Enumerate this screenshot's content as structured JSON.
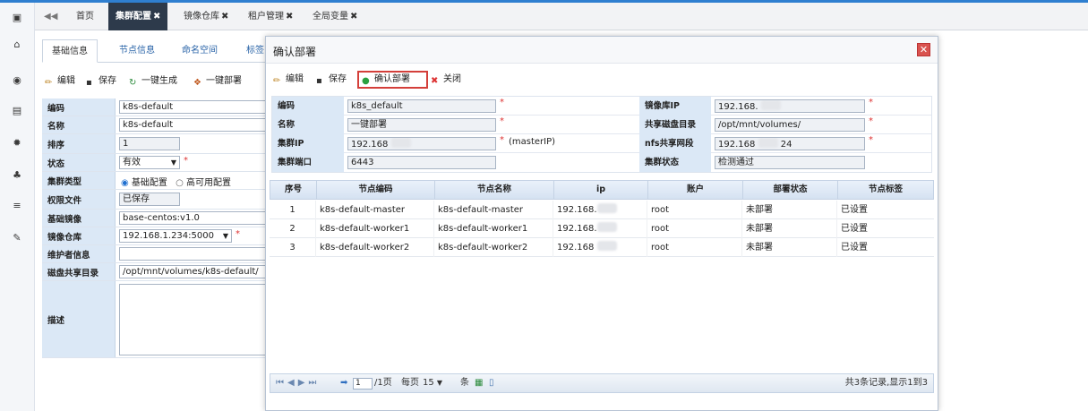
{
  "tabs": {
    "items": [
      "首页",
      "集群配置",
      "镜像仓库",
      "租户管理",
      "全局变量"
    ],
    "active_index": 1
  },
  "subtabs": [
    "基础信息",
    "节点信息",
    "命名空间",
    "标签"
  ],
  "toolbar": {
    "edit": "编辑",
    "save": "保存",
    "generate": "一键生成",
    "deploy": "一键部署"
  },
  "form": {
    "code_label": "编码",
    "code_value": "k8s-default",
    "name_label": "名称",
    "name_value": "k8s-default",
    "sort_label": "排序",
    "sort_value": "1",
    "status_label": "状态",
    "status_value": "有效",
    "type_label": "集群类型",
    "type_opt1": "基础配置",
    "type_opt2": "高可用配置",
    "perm_label": "权限文件",
    "perm_value": "已保存",
    "image_label": "基础镜像",
    "image_value": "base-centos:v1.0",
    "repo_label": "镜像仓库",
    "repo_value": "192.168.1.234:5000",
    "maint_label": "维护者信息",
    "maint_value": "",
    "disk_label": "磁盘共享目录",
    "disk_value": "/opt/mnt/volumes/k8s-default/",
    "desc_label": "描述",
    "desc_value": ""
  },
  "modal": {
    "title": "确认部署",
    "toolbar": {
      "edit": "编辑",
      "save": "保存",
      "confirm": "确认部署",
      "close": "关闭"
    },
    "fields": {
      "code_label": "编码",
      "code_value": "k8s_default",
      "name_label": "名称",
      "name_value": "一键部署",
      "ip_label": "集群IP",
      "ip_value": "192.168",
      "ip_note": "(masterIP)",
      "port_label": "集群端口",
      "port_value": "6443",
      "repoip_label": "镜像库IP",
      "repoip_value": "192.168.",
      "disk_label": "共享磁盘目录",
      "disk_value": "/opt/mnt/volumes/",
      "nfs_label": "nfs共享网段",
      "nfs_value_a": "192.168",
      "nfs_value_b": "24",
      "state_label": "集群状态",
      "state_value": "检测通过"
    },
    "grid": {
      "headers": [
        "序号",
        "节点编码",
        "节点名称",
        "ip",
        "账户",
        "部署状态",
        "节点标签"
      ],
      "rows": [
        {
          "no": "1",
          "code": "k8s-default-master",
          "name": "k8s-default-master",
          "ip": "192.168.",
          "account": "root",
          "deploy": "未部署",
          "label": "已设置"
        },
        {
          "no": "2",
          "code": "k8s-default-worker1",
          "name": "k8s-default-worker1",
          "ip": "192.168.",
          "account": "root",
          "deploy": "未部署",
          "label": "已设置"
        },
        {
          "no": "3",
          "code": "k8s-default-worker2",
          "name": "k8s-default-worker2",
          "ip": "192.168",
          "account": "root",
          "deploy": "未部署",
          "label": "已设置"
        }
      ]
    },
    "pager": {
      "page_value": "1",
      "page_total": "/1页",
      "per_page_label": "每页",
      "per_page_value": "15",
      "per_page_unit": "条",
      "summary": "共3条记录,显示1到3"
    }
  }
}
